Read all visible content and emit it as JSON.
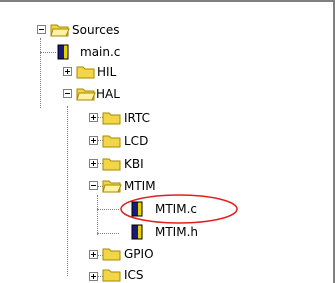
{
  "tree": {
    "nodes": [
      {
        "label": "Sources",
        "type": "folder-open",
        "expanded": true
      },
      {
        "label": "main.c",
        "type": "file"
      },
      {
        "label": "HIL",
        "type": "folder",
        "expanded": false
      },
      {
        "label": "HAL",
        "type": "folder-open",
        "expanded": true
      },
      {
        "label": "IRTC",
        "type": "folder",
        "expanded": false
      },
      {
        "label": "LCD",
        "type": "folder",
        "expanded": false
      },
      {
        "label": "KBI",
        "type": "folder",
        "expanded": false
      },
      {
        "label": "MTIM",
        "type": "folder-open",
        "expanded": true
      },
      {
        "label": "MTIM.c",
        "type": "file",
        "highlighted": true
      },
      {
        "label": "MTIM.h",
        "type": "file"
      },
      {
        "label": "GPIO",
        "type": "folder",
        "expanded": false
      },
      {
        "label": "ICS",
        "type": "folder",
        "expanded": false
      }
    ]
  },
  "colors": {
    "folder": "#f2d648",
    "folder_dark": "#a68a00",
    "file_blue": "#1a1a7a",
    "file_yellow": "#e8d200",
    "highlight": "#e02020"
  },
  "icons": {
    "folder": "folder-icon",
    "folder_open": "folder-open-icon",
    "file": "c-source-file-icon"
  }
}
